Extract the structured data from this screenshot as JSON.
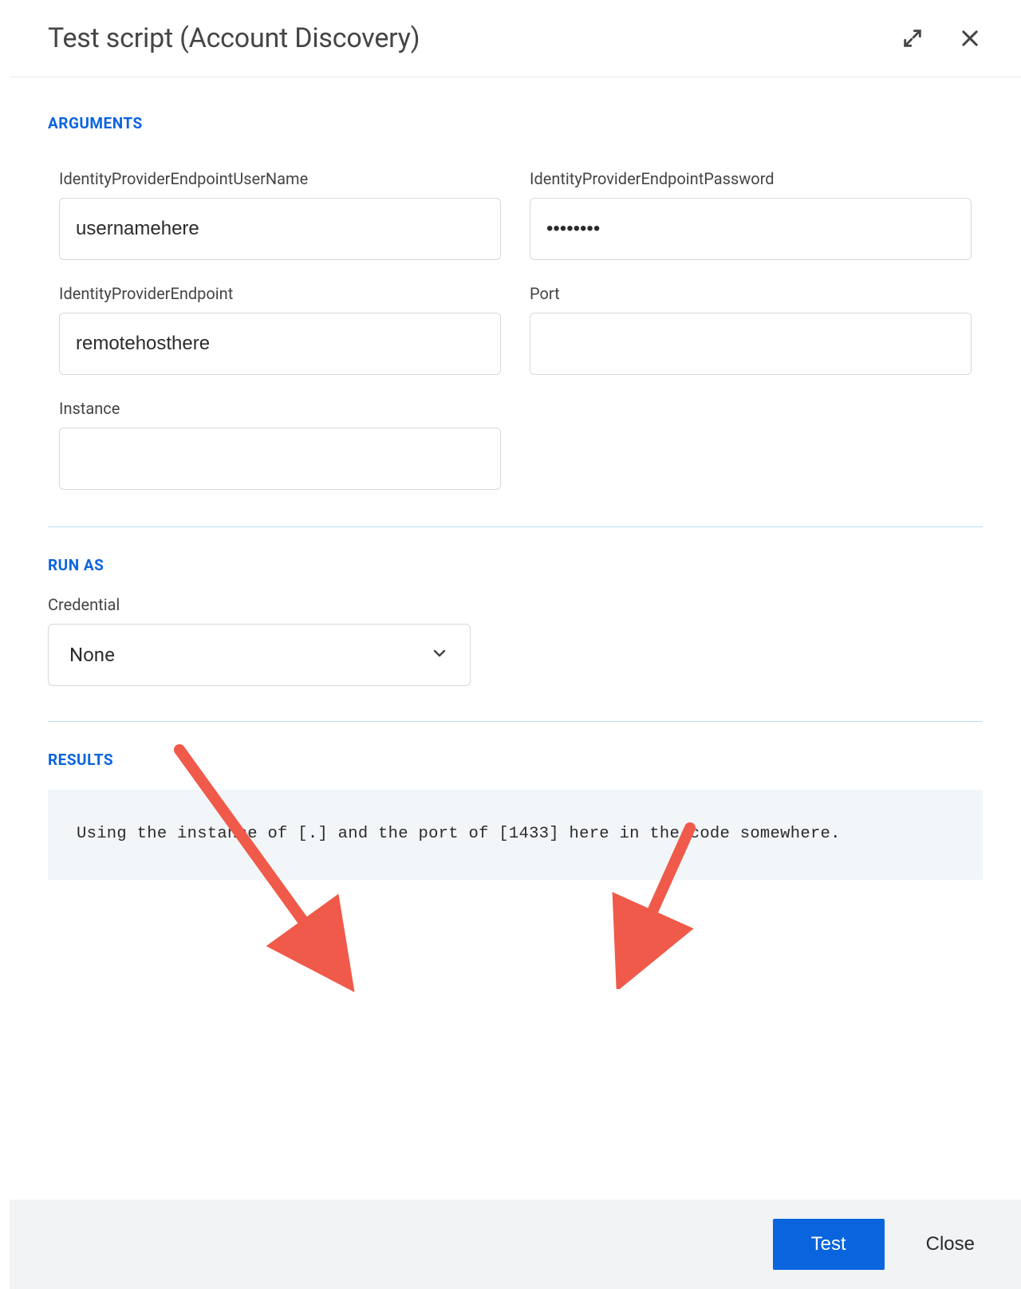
{
  "modal": {
    "title": "Test script (Account Discovery)"
  },
  "sections": {
    "arguments": "ARGUMENTS",
    "runas": "RUN AS",
    "results": "RESULTS"
  },
  "fields": {
    "username": {
      "label": "IdentityProviderEndpointUserName",
      "value": "usernamehere"
    },
    "password": {
      "label": "IdentityProviderEndpointPassword",
      "value": "••••••••"
    },
    "endpoint": {
      "label": "IdentityProviderEndpoint",
      "value": "remotehosthere"
    },
    "port": {
      "label": "Port",
      "value": ""
    },
    "instance": {
      "label": "Instance",
      "value": ""
    }
  },
  "runas": {
    "credential_label": "Credential",
    "credential_value": "None"
  },
  "results": {
    "text": "Using the instance of [.] and the port of [1433] here in the code somewhere."
  },
  "footer": {
    "test": "Test",
    "close": "Close"
  }
}
